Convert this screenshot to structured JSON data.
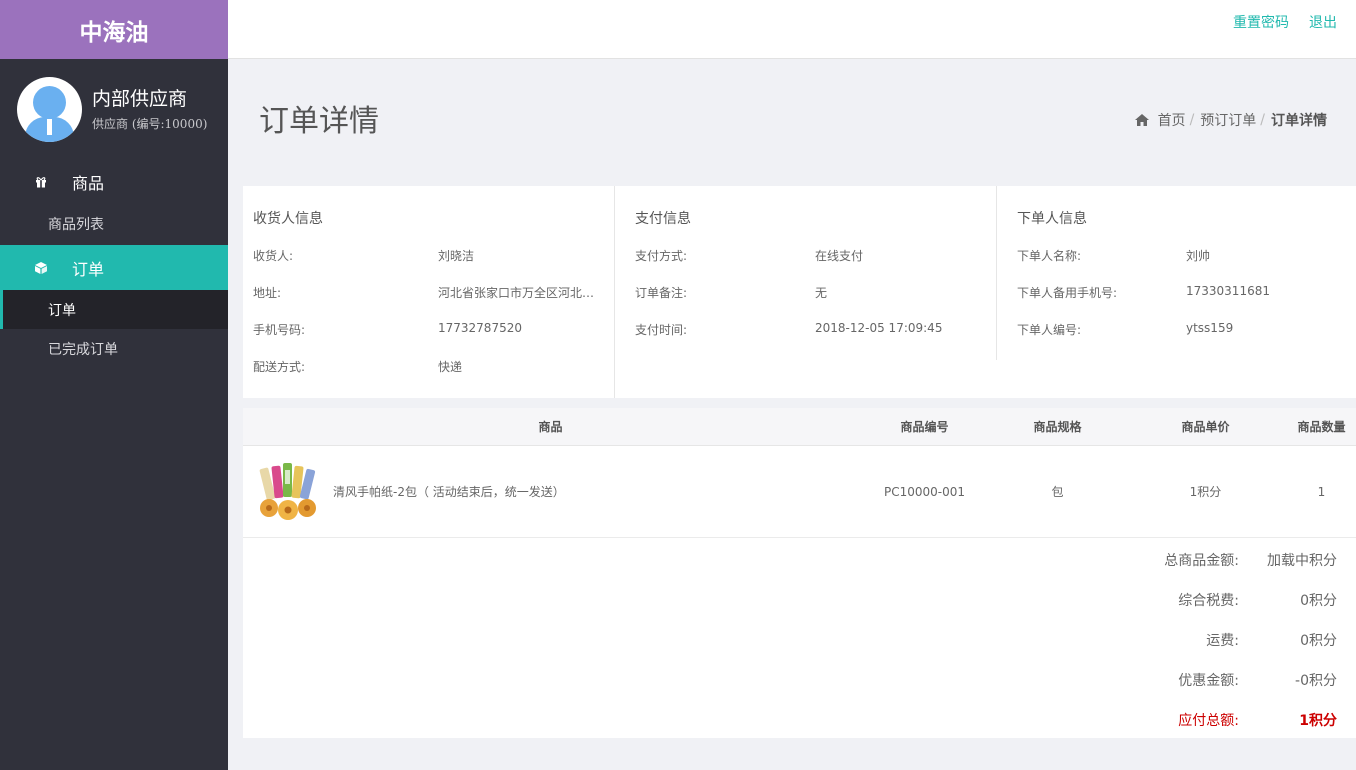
{
  "brand": "中海油",
  "profile": {
    "name": "内部供应商",
    "sub": "供应商 (编号:10000)"
  },
  "nav": {
    "goods_label": "商品",
    "goods_list": "商品列表",
    "orders_label": "订单",
    "orders": "订单",
    "completed_orders": "已完成订单"
  },
  "topbar": {
    "reset_password": "重置密码",
    "logout": "退出"
  },
  "page": {
    "title": "订单详情"
  },
  "breadcrumb": {
    "home": "首页",
    "preorder": "预订订单",
    "current": "订单详情",
    "sep": "/"
  },
  "receiver": {
    "title": "收货人信息",
    "name_label": "收货人:",
    "name": "刘晓洁",
    "address_label": "地址:",
    "address": "河北省张家口市万全区河北…",
    "phone_label": "手机号码:",
    "phone": "17732787520",
    "delivery_label": "配送方式:",
    "delivery": "快递"
  },
  "payment": {
    "title": "支付信息",
    "method_label": "支付方式:",
    "method": "在线支付",
    "note_label": "订单备注:",
    "note": "无",
    "time_label": "支付时间:",
    "time": "2018-12-05 17:09:45"
  },
  "orderer": {
    "title": "下单人信息",
    "name_label": "下单人名称:",
    "name": "刘帅",
    "phone_label": "下单人备用手机号:",
    "phone": "17330311681",
    "id_label": "下单人编号:",
    "id": "ytss159"
  },
  "table": {
    "headers": {
      "name": "商品",
      "code": "商品编号",
      "spec": "商品规格",
      "price": "商品单价",
      "qty": "商品数量"
    },
    "rows": [
      {
        "name": "清风手帕纸-2包（ 活动结束后，统一发送）",
        "code": "PC10000-001",
        "spec": "包",
        "price": "1积分",
        "qty": "1"
      }
    ]
  },
  "summary": {
    "total_goods_label": "总商品金额:",
    "total_goods": "加载中积分",
    "tax_label": "综合税费:",
    "tax": "0积分",
    "shipping_label": "运费:",
    "shipping": "0积分",
    "discount_label": "优惠金额:",
    "discount": "-0积分",
    "payable_label": "应付总额:",
    "payable": "1积分"
  },
  "colors": {
    "accent": "#21b9ae",
    "brand": "#9b72bd",
    "sidebar": "#30313b",
    "total": "#cc0000"
  }
}
